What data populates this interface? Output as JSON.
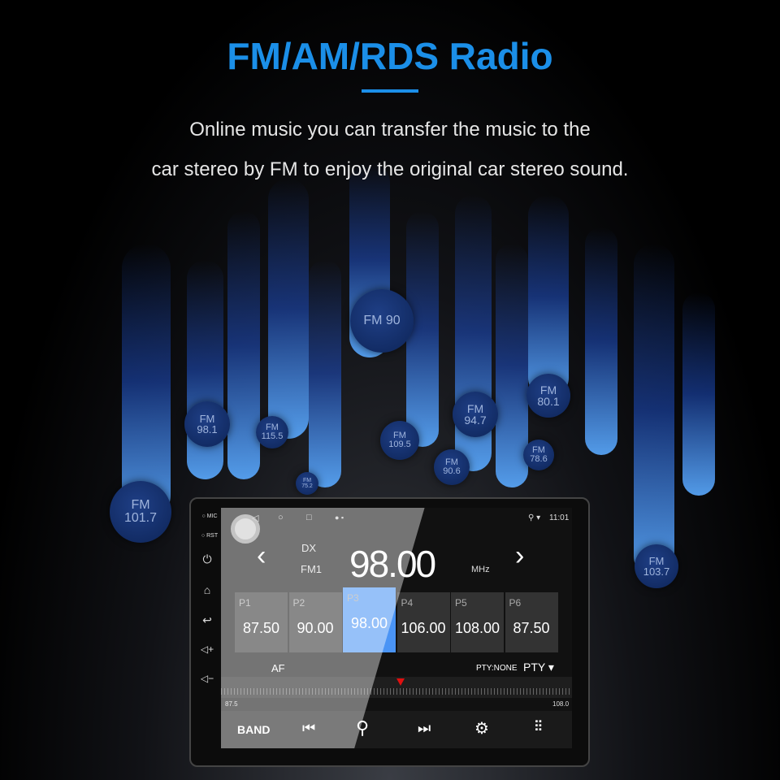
{
  "header": {
    "title": "FM/AM/RDS Radio",
    "subtitle_line1": "Online music you can transfer the music to the",
    "subtitle_line2": "car stereo by FM to enjoy the original car stereo sound."
  },
  "bubbles": [
    {
      "label": "FM 90"
    },
    {
      "label": "FM",
      "freq": "98.1"
    },
    {
      "label": "FM",
      "freq": "115.5"
    },
    {
      "label": "FM",
      "freq": "109.5"
    },
    {
      "label": "FM",
      "freq": "94.7"
    },
    {
      "label": "FM",
      "freq": "80.1"
    },
    {
      "label": "FM",
      "freq": "78.6"
    },
    {
      "label": "FM",
      "freq": "90.6"
    },
    {
      "label": "FM",
      "freq": "75.2"
    },
    {
      "label": "FM",
      "freq": "101.7"
    },
    {
      "label": "FM",
      "freq": "103.7"
    }
  ],
  "device": {
    "side": {
      "mic": "MIC",
      "rst": "RST"
    },
    "status": {
      "time": "11:01"
    },
    "radio": {
      "dx": "DX",
      "band_name": "FM1",
      "frequency": "98.00",
      "unit": "MHz",
      "presets": [
        {
          "label": "P1",
          "value": "87.50"
        },
        {
          "label": "P2",
          "value": "90.00"
        },
        {
          "label": "P3",
          "value": "98.00",
          "active": true
        },
        {
          "label": "P4",
          "value": "106.00"
        },
        {
          "label": "P5",
          "value": "108.00"
        },
        {
          "label": "P6",
          "value": "87.50"
        }
      ],
      "af": "AF",
      "pty_status": "PTY:NONE",
      "pty_button": "PTY",
      "scale_min": "87.5",
      "scale_max": "108.0",
      "tuner_position_mhz": 98.0
    },
    "toolbar": {
      "band": "BAND"
    },
    "colors": {
      "accent": "#1b8fe8",
      "active_preset": "#4a94f5",
      "needle": "#e01010"
    }
  }
}
